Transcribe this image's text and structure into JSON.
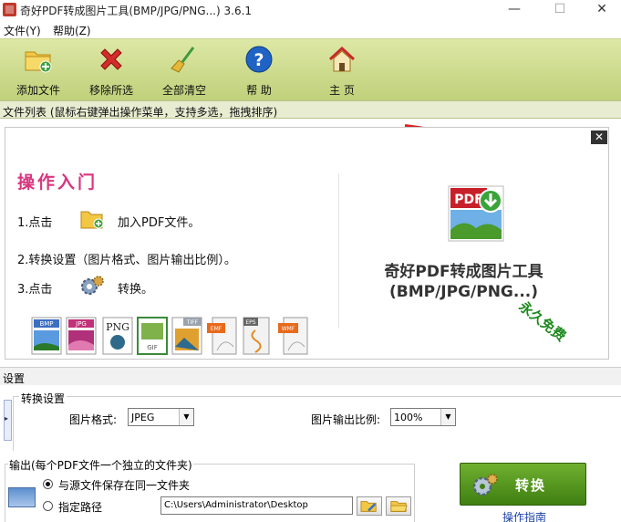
{
  "window": {
    "title": "奇好PDF转成图片工具(BMP/JPG/PNG...) 3.6.1",
    "minimize": "—",
    "maximize": "☐",
    "close": "✕"
  },
  "menu": {
    "items": [
      "文件(Y)",
      "帮助(Z)"
    ]
  },
  "toolbar": {
    "items": [
      {
        "label": "添加文件",
        "icon": "add-folder-icon"
      },
      {
        "label": "移除所选",
        "icon": "remove-icon"
      },
      {
        "label": "全部清空",
        "icon": "broom-icon"
      },
      {
        "label": "帮 助",
        "icon": "help-icon"
      },
      {
        "label": "主 页",
        "icon": "home-icon"
      }
    ]
  },
  "filelist": {
    "header": "文件列表   (鼠标右键弹出操作菜单，支持多选，拖拽排序)"
  },
  "guide": {
    "close": "✕",
    "title": "操作入门",
    "step1_prefix": "1.点击",
    "step1_suffix": "加入PDF文件。",
    "step2": "2.转换设置（图片格式、图片输出比例）。",
    "step3_prefix": "3.点击",
    "step3_suffix": "转换。",
    "brand_line1": "奇好PDF转成图片工具",
    "brand_line2": "(BMP/JPG/PNG...)",
    "free_text": "永久免费",
    "formats": [
      "BMP",
      "JPG",
      "PNG",
      "GIF",
      "TIFF",
      "EMF",
      "EPS",
      "WMF"
    ]
  },
  "settings": {
    "header": "设置",
    "convert_group": "转换设置",
    "format_label": "图片格式:",
    "format_value": "JPEG",
    "ratio_label": "图片输出比例:",
    "ratio_value": "100%"
  },
  "output": {
    "group_title": "输出(每个PDF文件一个独立的文件夹)",
    "option_same": "与源文件保存在同一文件夹",
    "option_path": "指定路径",
    "path_value": "C:\\Users\\Administrator\\Desktop",
    "selected": "same"
  },
  "convert": {
    "label": "转换",
    "guide_link": "操作指南"
  },
  "colors": {
    "accent": "#d9357f",
    "toolbar_top": "#dde8a6",
    "toolbar_bottom": "#c0d07a",
    "convert_button": "#4f9420",
    "free_text": "#1f8a1f",
    "arrow": "#e02020"
  }
}
